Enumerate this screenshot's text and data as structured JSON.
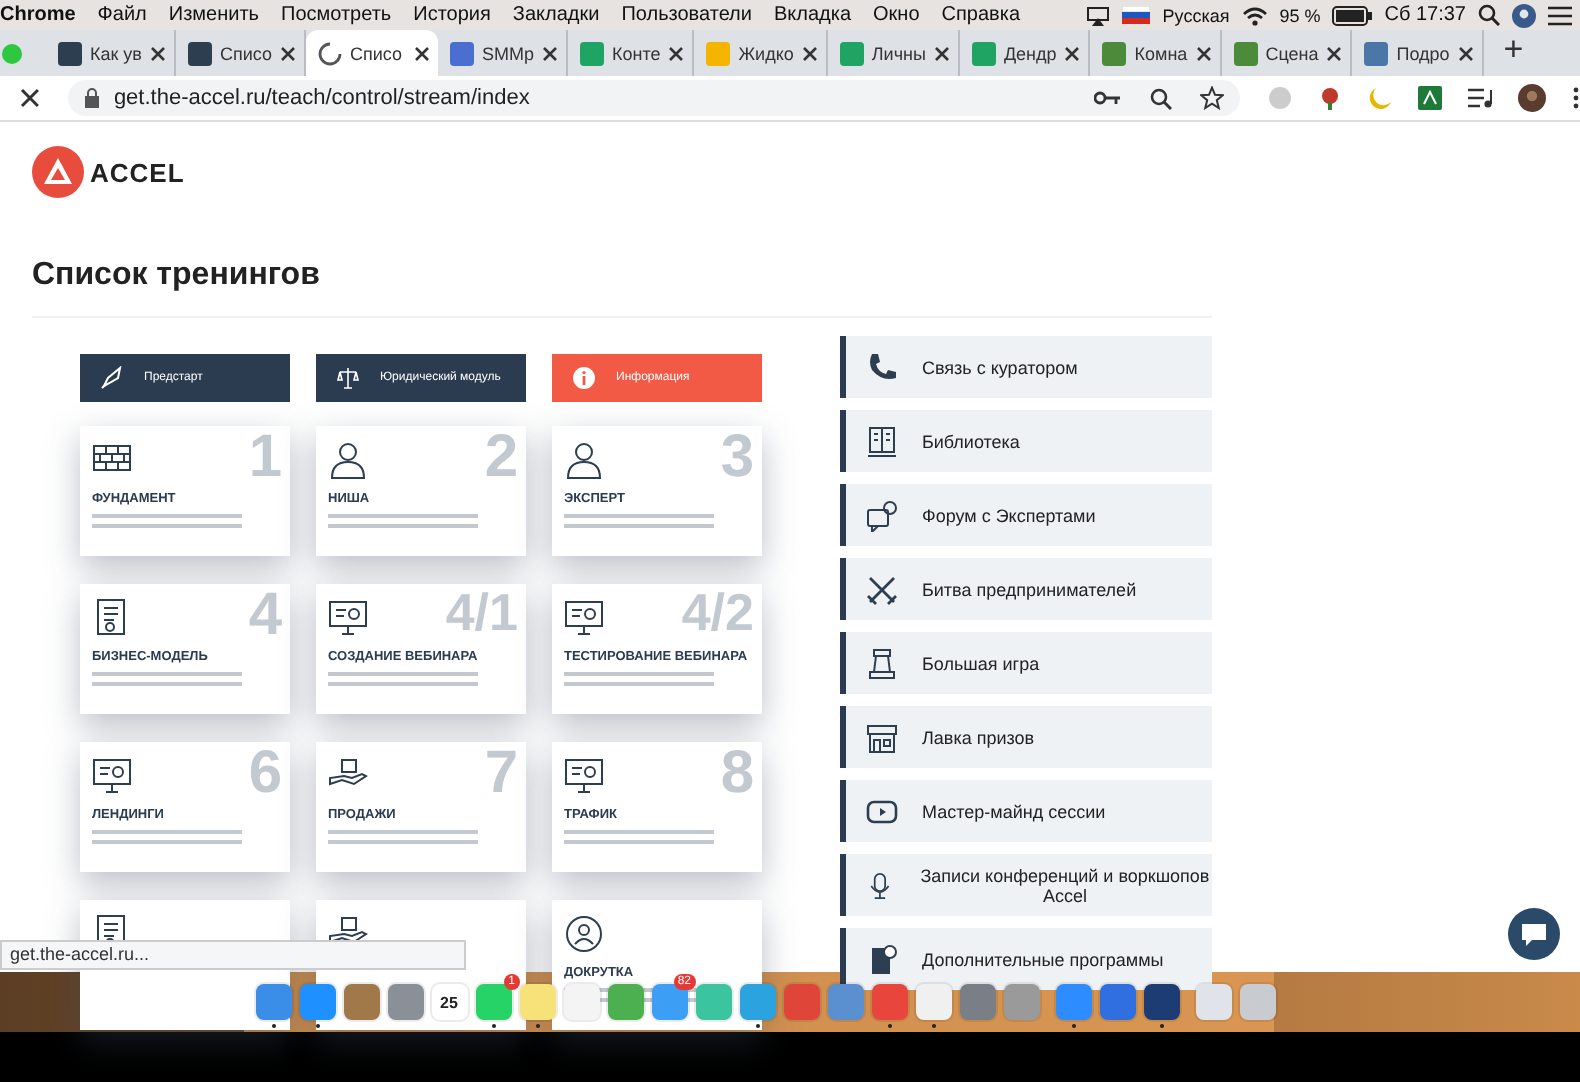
{
  "menu_bar": {
    "app": "Chrome",
    "items": [
      "Файл",
      "Изменить",
      "Посмотреть",
      "История",
      "Закладки",
      "Пользователи",
      "Вкладка",
      "Окно",
      "Справка"
    ],
    "input_source": "Русская",
    "battery": "95 %",
    "clock": "Сб 17:37"
  },
  "tabs": [
    {
      "title": "Как ув",
      "selected": false,
      "color": "#2d3e50"
    },
    {
      "title": "Списо",
      "selected": false,
      "color": "#2d3e50"
    },
    {
      "title": "Списо",
      "selected": true
    },
    {
      "title": "SMMp",
      "selected": false,
      "color": "#4a6fd0"
    },
    {
      "title": "Конте",
      "selected": false,
      "color": "#1fa463"
    },
    {
      "title": "Жидко",
      "selected": false,
      "color": "#f4b400"
    },
    {
      "title": "Личны",
      "selected": false,
      "color": "#1fa463"
    },
    {
      "title": "Дендр",
      "selected": false,
      "color": "#1fa463"
    },
    {
      "title": "Комна",
      "selected": false,
      "color": "#4c8b3a"
    },
    {
      "title": "Сцена",
      "selected": false,
      "color": "#4c8b3a"
    },
    {
      "title": "Подро",
      "selected": false,
      "color": "#4a76a8"
    }
  ],
  "new_tab": "+",
  "address_bar": {
    "url": "get.the-accel.ru/teach/control/stream/index"
  },
  "logo": {
    "text": "ACCEL"
  },
  "page_title": "Список тренингов",
  "module_buttons": [
    {
      "label": "Предстарт",
      "kind": "dark"
    },
    {
      "label": "Юридический модуль",
      "kind": "dark"
    },
    {
      "label": "Информация",
      "kind": "accent"
    }
  ],
  "modules": [
    {
      "number": "1",
      "title": "ФУНДАМЕНТ"
    },
    {
      "number": "2",
      "title": "НИША"
    },
    {
      "number": "3",
      "title": "ЭКСПЕРТ"
    },
    {
      "number": "4",
      "title": "БИЗНЕС-МОДЕЛЬ"
    },
    {
      "number": "4/1",
      "title": "СОЗДАНИЕ ВЕБИНАРА"
    },
    {
      "number": "4/2",
      "title": "ТЕСТИРОВАНИЕ ВЕБИНАРА"
    },
    {
      "number": "6",
      "title": "ЛЕНДИНГИ"
    },
    {
      "number": "7",
      "title": "ПРОДАЖИ"
    },
    {
      "number": "8",
      "title": "ТРАФИК"
    },
    {
      "kind": "covered"
    },
    {
      "kind": "covered"
    },
    {
      "kind": "module",
      "title": "ДОКРУТКА"
    }
  ],
  "side_menu": [
    {
      "label": "Связь с куратором"
    },
    {
      "label": "Библиотека"
    },
    {
      "label": "Форум с Экспертами"
    },
    {
      "label": "Битва предпринимателей"
    },
    {
      "label": "Большая игра"
    },
    {
      "label": "Лавка призов"
    },
    {
      "label": "Мастер-майнд сессии"
    },
    {
      "label": "Записи конференций и воркшопов Accel"
    },
    {
      "label": "Дополнительные программы"
    }
  ],
  "status_url": "get.the-accel.ru...",
  "dock": [
    {
      "kind": "app",
      "color": "#3b8ee8",
      "running": true
    },
    {
      "kind": "app",
      "color": "#1e90ff",
      "running": true
    },
    {
      "kind": "app",
      "color": "#a0784a",
      "running": false
    },
    {
      "kind": "app",
      "color": "#8a8f98",
      "running": false
    },
    {
      "kind": "app",
      "color": "#ffffff",
      "running": false,
      "text": "25"
    },
    {
      "kind": "app",
      "color": "#25d366",
      "running": true,
      "badge": "1"
    },
    {
      "kind": "app",
      "color": "#f7e27a",
      "running": true
    },
    {
      "kind": "app",
      "color": "#f4f4f4",
      "running": false
    },
    {
      "kind": "app",
      "color": "#4caf50",
      "running": false
    },
    {
      "kind": "app",
      "color": "#3c9ef5",
      "running": false,
      "badge": "82"
    },
    {
      "kind": "app",
      "color": "#3bc4a0",
      "running": false
    },
    {
      "kind": "app",
      "color": "#2aa3df",
      "running": true
    },
    {
      "kind": "app",
      "color": "#e0453a",
      "running": false
    },
    {
      "kind": "app",
      "color": "#5a8fd0",
      "running": false
    },
    {
      "kind": "app",
      "color": "#e8453c",
      "running": true
    },
    {
      "kind": "app",
      "color": "#f0f0f0",
      "running": true
    },
    {
      "kind": "app",
      "color": "#7a7f87",
      "running": false
    },
    {
      "kind": "app",
      "color": "#9a9a9a",
      "running": false
    },
    {
      "kind": "separator"
    },
    {
      "kind": "app",
      "color": "#2d8cff",
      "running": true
    },
    {
      "kind": "app",
      "color": "#2f6fe0",
      "running": false
    },
    {
      "kind": "app",
      "color": "#1d3c73",
      "running": true
    },
    {
      "kind": "separator"
    },
    {
      "kind": "app",
      "color": "#e0e4ea",
      "running": false
    },
    {
      "kind": "app",
      "color": "#c8ccd0",
      "running": false
    }
  ]
}
